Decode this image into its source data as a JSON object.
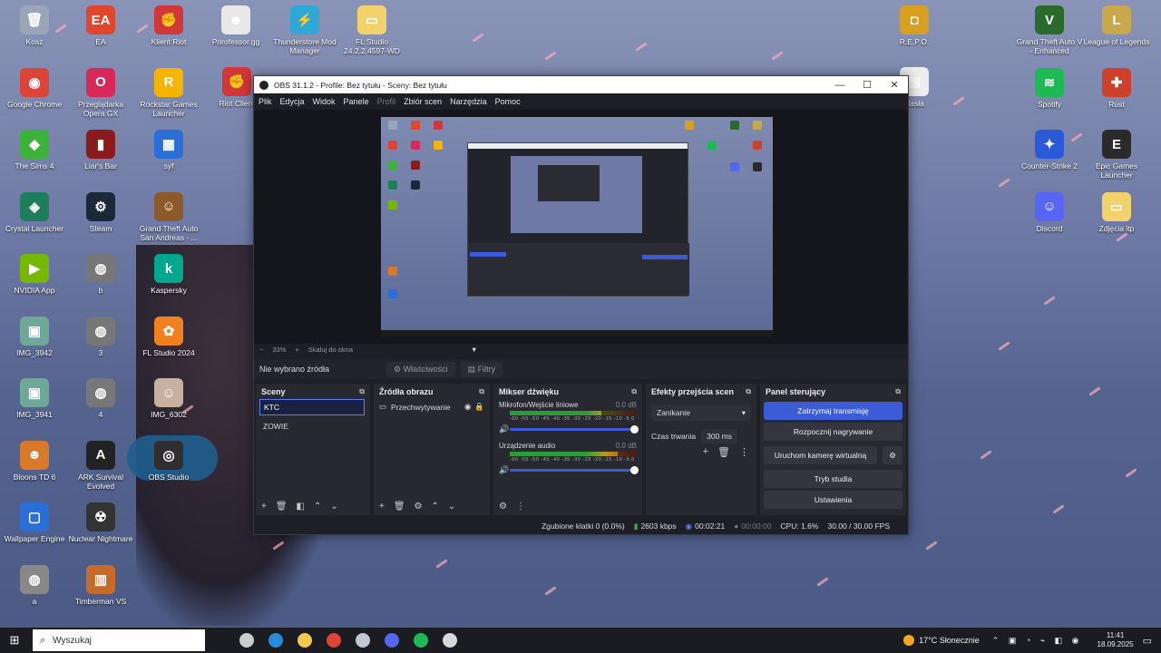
{
  "desktop": {
    "icons_left": [
      {
        "label": "Kosz",
        "color": "#9aa6b8",
        "glyph": "🗑"
      },
      {
        "label": "Google Chrome",
        "color": "#db4437",
        "glyph": "◉"
      },
      {
        "label": "The Sims 4",
        "color": "#3bb33b",
        "glyph": "◆"
      },
      {
        "label": "Crystal Launcher",
        "color": "#1e7d5a",
        "glyph": "◈"
      },
      {
        "label": "NVIDIA App",
        "color": "#76b900",
        "glyph": "▶"
      },
      {
        "label": "IMG_3942",
        "color": "#6fa89a",
        "glyph": "▣"
      },
      {
        "label": "IMG_3941",
        "color": "#6fa89a",
        "glyph": "▣"
      },
      {
        "label": "Bloons TD 6",
        "color": "#d87a2a",
        "glyph": "☻"
      },
      {
        "label": "Wallpaper Engine",
        "color": "#2a6fd8",
        "glyph": "▢"
      },
      {
        "label": "a",
        "color": "#888888",
        "glyph": "◍"
      }
    ],
    "icons_col2": [
      {
        "label": "EA",
        "color": "#e0462c",
        "glyph": "EA"
      },
      {
        "label": "Przeglądarka Opera GX",
        "color": "#d8285a",
        "glyph": "O"
      },
      {
        "label": "Liar's Bar",
        "color": "#8b1a1a",
        "glyph": "▮"
      },
      {
        "label": "Steam",
        "color": "#1b2838",
        "glyph": "⚙"
      },
      {
        "label": "b",
        "color": "#777777",
        "glyph": "◍"
      },
      {
        "label": "3",
        "color": "#777777",
        "glyph": "◍"
      },
      {
        "label": "4",
        "color": "#777777",
        "glyph": "◍"
      },
      {
        "label": "ARK Survival Evolved",
        "color": "#222222",
        "glyph": "A"
      },
      {
        "label": "Nuclear Nightmare",
        "color": "#333333",
        "glyph": "☢"
      },
      {
        "label": "Timberman VS",
        "color": "#c86a2a",
        "glyph": "▥"
      }
    ],
    "icons_col3": [
      {
        "label": "Klient Riot",
        "color": "#d13639",
        "glyph": "✊"
      },
      {
        "label": "Rockstar Games Launcher",
        "color": "#f4b400",
        "glyph": "R"
      },
      {
        "label": "syf",
        "color": "#2a6fd8",
        "glyph": "▦"
      },
      {
        "label": "Grand Theft Auto San Andreas - ...",
        "color": "#8a5a2a",
        "glyph": "☺"
      },
      {
        "label": "Kaspersky",
        "color": "#00a88e",
        "glyph": "k"
      },
      {
        "label": "FL Studio 2024",
        "color": "#f08020",
        "glyph": "✿"
      },
      {
        "label": "IMG_6302",
        "color": "#c8b0a0",
        "glyph": "☺"
      },
      {
        "label": "OBS Studio",
        "color": "#302e31",
        "glyph": "◎"
      }
    ],
    "icons_row_top": [
      {
        "label": "Porofessor.gg",
        "color": "#e8e8e8",
        "glyph": "☻"
      },
      {
        "label": "Thunderstore Mod Manager",
        "color": "#2fa8d8",
        "glyph": "⚡"
      },
      {
        "label": "FL Studio 24.2.2.4597-WD",
        "color": "#f2d36b",
        "glyph": "▭"
      }
    ],
    "riot_partial": {
      "label": "Riot Client",
      "color": "#d13639",
      "glyph": "✊"
    },
    "icons_right_col1": [
      {
        "label": "R.E.P.O.",
        "color": "#d8a020",
        "glyph": "◘"
      },
      {
        "label": "Hasła",
        "color": "#eeeeee",
        "glyph": "▤"
      }
    ],
    "icons_right_col2": [
      {
        "label": "Grand Theft Auto V - Enhanced",
        "color": "#2a6a2a",
        "glyph": "V"
      },
      {
        "label": "Spotify",
        "color": "#1db954",
        "glyph": "≋"
      },
      {
        "label": "Counter-Strike 2",
        "color": "#2a5ad8",
        "glyph": "✦"
      },
      {
        "label": "Discord",
        "color": "#5865f2",
        "glyph": "☺"
      }
    ],
    "icons_right_col3": [
      {
        "label": "League of Legends",
        "color": "#c8a84a",
        "glyph": "L"
      },
      {
        "label": "Rust",
        "color": "#cd412b",
        "glyph": "✚"
      },
      {
        "label": "Epic Games Launcher",
        "color": "#2a2a2a",
        "glyph": "E"
      },
      {
        "label": "Zdjęcia itp",
        "color": "#f2d36b",
        "glyph": "▭"
      }
    ]
  },
  "obs": {
    "window_title": "OBS 31.1.2 - Profile: Bez tytułu - Sceny: Bez tytułu",
    "menu": [
      "Plik",
      "Edycja",
      "Widok",
      "Panele",
      "Profil",
      "Zbiór scen",
      "Narzędzia",
      "Pomoc"
    ],
    "zoom": "33%",
    "scale_mode": "Skaluj do okna",
    "no_source": "Nie wybrano źródła",
    "properties_btn": "Właściwości",
    "filters_btn": "Filtry",
    "scenes": {
      "title": "Sceny",
      "items": [
        "KTC",
        "ZOWIE"
      ],
      "selected": "KTC"
    },
    "sources": {
      "title": "Źródła obrazu",
      "items": [
        "Przechwytywanie"
      ]
    },
    "mixer": {
      "title": "Mikser dźwięku",
      "channels": [
        {
          "name": "Mikrofon/Wejście liniowe",
          "db": "0.0 dB",
          "level": 0.72
        },
        {
          "name": "Urządzenie audio",
          "db": "0.0 dB",
          "level": 0.85
        }
      ],
      "scale": "-60 -55 -50 -45 -40 -35 -30 -25 -20 -15 -10 -5 0"
    },
    "transitions": {
      "title": "Efekty przejścia scen",
      "type": "Zanikanie",
      "duration_label": "Czas trwania",
      "duration": "300 ms"
    },
    "controls": {
      "title": "Panel sterujący",
      "stop_stream": "Zatrzymaj transmisję",
      "start_record": "Rozpocznij nagrywanie",
      "virtual_cam": "Uruchom kamerę wirtualną",
      "studio_mode": "Tryb studia",
      "settings": "Ustawienia"
    },
    "status": {
      "dropped": "Zgubione klatki 0 (0.0%)",
      "bitrate": "2603 kbps",
      "stream_time": "00:02:21",
      "rec_time": "00:00:00",
      "cpu": "CPU: 1.6%",
      "fps": "30.00 / 30.00 FPS"
    }
  },
  "taskbar": {
    "search_placeholder": "Wyszukaj",
    "apps": [
      {
        "name": "task-view-icon",
        "color": "#cccccc"
      },
      {
        "name": "edge-icon",
        "color": "#2a8ad8"
      },
      {
        "name": "explorer-icon",
        "color": "#f2c94c"
      },
      {
        "name": "chrome-icon",
        "color": "#db4437"
      },
      {
        "name": "steam-icon",
        "color": "#c0c8d8"
      },
      {
        "name": "discord-icon",
        "color": "#5865f2"
      },
      {
        "name": "spotify-icon",
        "color": "#1db954"
      },
      {
        "name": "obs-icon",
        "color": "#d8d8d8"
      }
    ],
    "weather": "17°C Słonecznie",
    "time": "11:41",
    "date": "18.09.2025"
  }
}
